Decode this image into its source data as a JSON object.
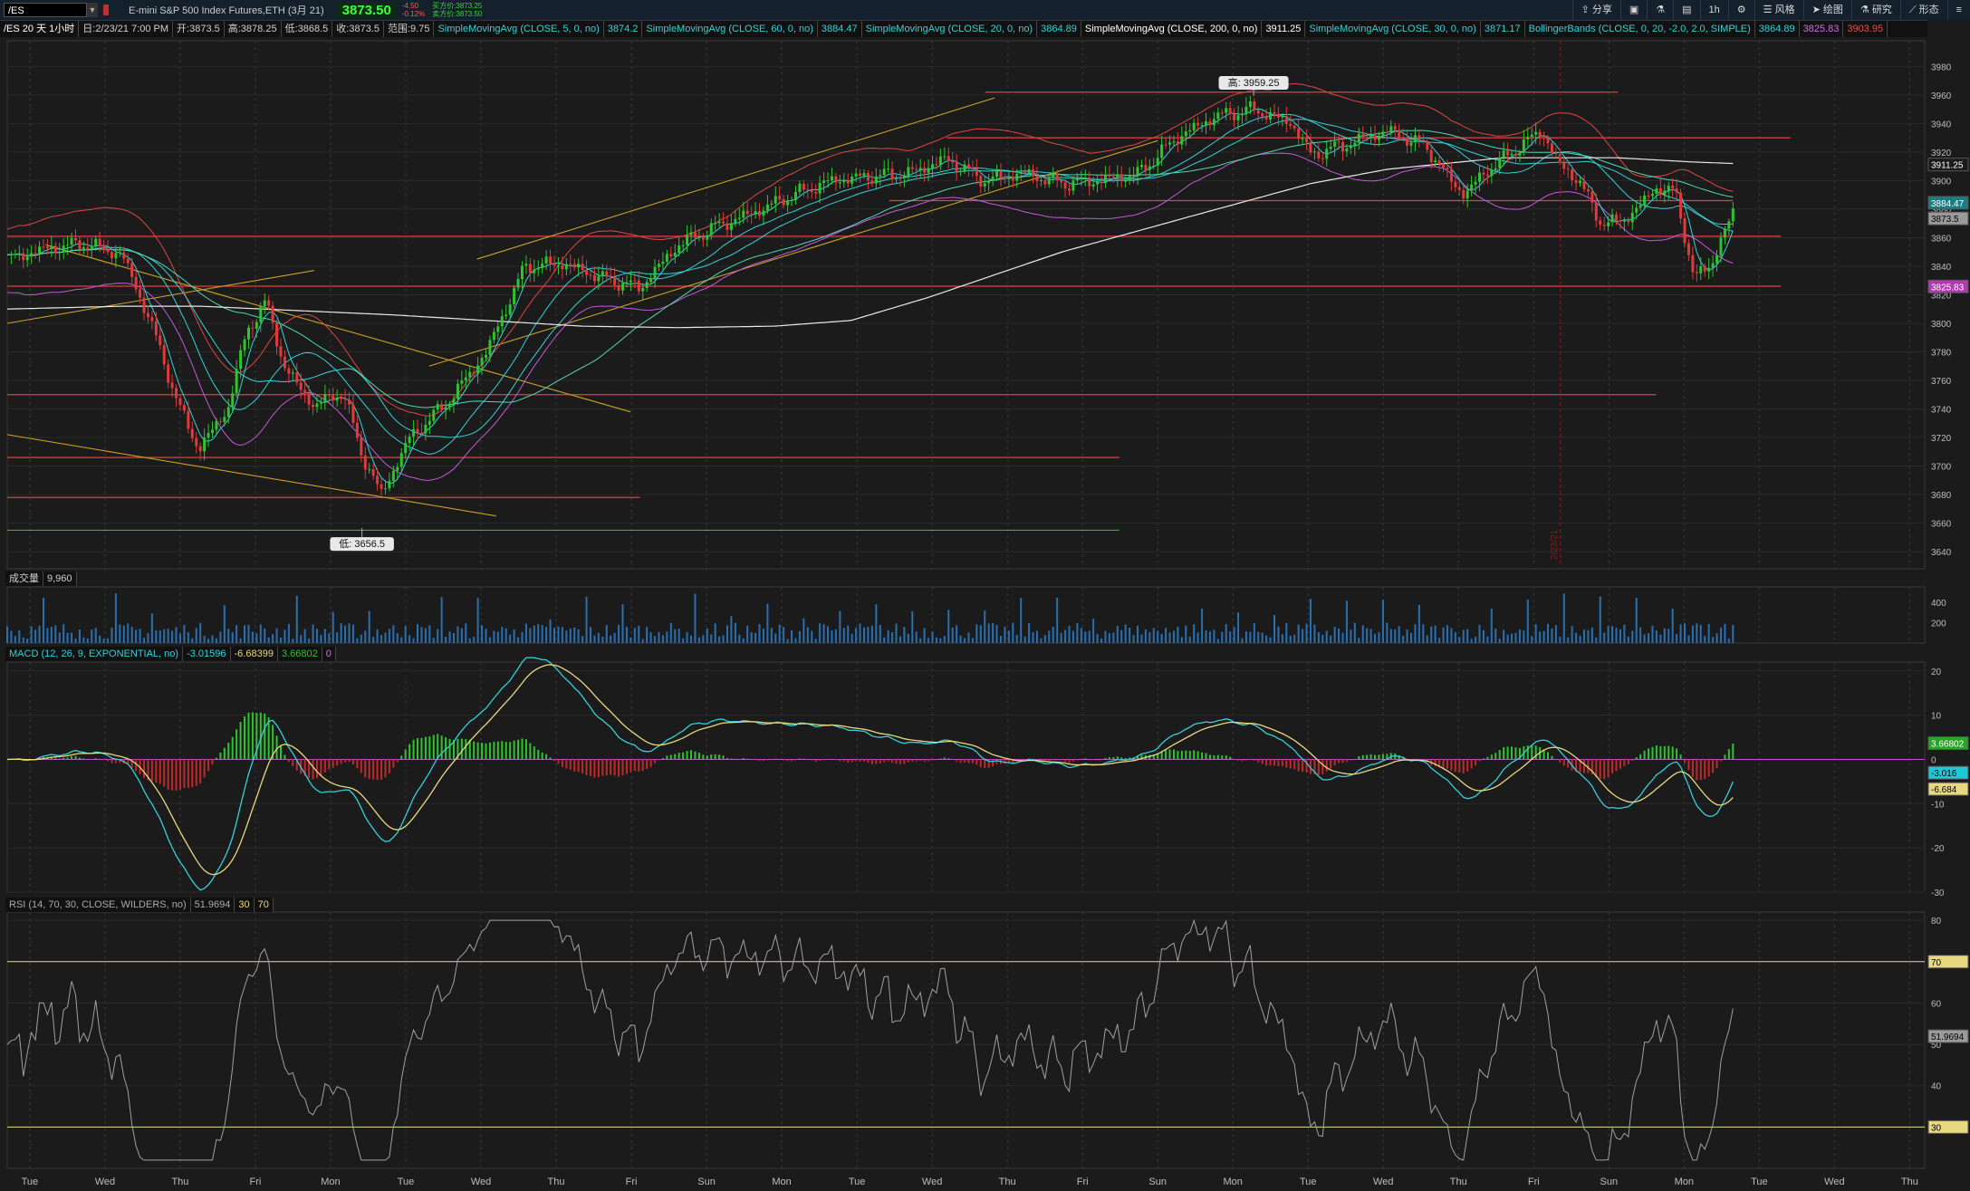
{
  "toolbar": {
    "symbol": "/ES",
    "description": "E-mini S&P 500 Index Futures,ETH (3月 21)",
    "last_price": "3873.50",
    "change": "-4.50",
    "change_pct": "-0.12%",
    "bid": "买方价:3873.25",
    "ask": "卖方价:3873.50",
    "buttons": [
      "分享",
      "",
      "",
      "",
      "1h",
      "",
      "风格",
      "绘图",
      "研究",
      "形态"
    ]
  },
  "info_bar": {
    "timeframe": "/ES 20 天 1小时",
    "date": "日:2/23/21 7:00 PM",
    "open": "开:3873.5",
    "high": "高:3878.25",
    "low": "低:3868.5",
    "close": "收:3873.5",
    "range": "范围:9.75",
    "studies": [
      {
        "label": "SimpleMovingAvg (CLOSE, 5, 0, no)",
        "value": "3874.2",
        "color": "#35d0d8"
      },
      {
        "label": "SimpleMovingAvg (CLOSE, 60, 0, no)",
        "value": "3884.47",
        "color": "#35d0d8"
      },
      {
        "label": "SimpleMovingAvg (CLOSE, 20, 0, no)",
        "value": "3864.89",
        "color": "#35d0d8"
      },
      {
        "label": "SimpleMovingAvg (CLOSE, 200, 0, no)",
        "value": "3911.25",
        "color": "#ffffff"
      },
      {
        "label": "SimpleMovingAvg (CLOSE, 30, 0, no)",
        "value": "3871.17",
        "color": "#35d0d8"
      },
      {
        "label": "BollingerBands (CLOSE, 0, 20, -2.0, 2.0, SIMPLE)",
        "value": "3864.89",
        "value2": "3825.83",
        "value3": "3903.95",
        "color": "#35d0d8"
      }
    ]
  },
  "chart_data": [
    {
      "type": "candlestick",
      "panel": "price",
      "ylim": [
        3628,
        3998
      ],
      "yticks": [
        3640,
        3660,
        3680,
        3700,
        3720,
        3740,
        3760,
        3780,
        3800,
        3820,
        3840,
        3860,
        3880,
        3900,
        3920,
        3940,
        3960,
        3980
      ],
      "x_day_labels": [
        "Tue",
        "Wed",
        "Thu",
        "Fri",
        "Mon",
        "Tue",
        "Wed",
        "Thu",
        "Fri",
        "Sun",
        "Mon",
        "Tue",
        "Wed",
        "Thu",
        "Fri",
        "Sun",
        "Mon",
        "Tue",
        "Wed",
        "Thu",
        "Fri",
        "Sun",
        "Mon",
        "Tue",
        "Wed",
        "Thu"
      ],
      "close_path_points": [
        [
          0,
          3845
        ],
        [
          0.02,
          3852
        ],
        [
          0.04,
          3856
        ],
        [
          0.06,
          3848
        ],
        [
          0.075,
          3800
        ],
        [
          0.09,
          3740
        ],
        [
          0.1,
          3712
        ],
        [
          0.115,
          3740
        ],
        [
          0.125,
          3795
        ],
        [
          0.135,
          3815
        ],
        [
          0.145,
          3768
        ],
        [
          0.16,
          3742
        ],
        [
          0.175,
          3752
        ],
        [
          0.185,
          3708
        ],
        [
          0.195,
          3680
        ],
        [
          0.21,
          3720
        ],
        [
          0.23,
          3745
        ],
        [
          0.25,
          3780
        ],
        [
          0.27,
          3840
        ],
        [
          0.29,
          3842
        ],
        [
          0.31,
          3832
        ],
        [
          0.33,
          3825
        ],
        [
          0.35,
          3855
        ],
        [
          0.37,
          3868
        ],
        [
          0.39,
          3878
        ],
        [
          0.41,
          3890
        ],
        [
          0.43,
          3900
        ],
        [
          0.45,
          3903
        ],
        [
          0.47,
          3905
        ],
        [
          0.49,
          3915
        ],
        [
          0.51,
          3900
        ],
        [
          0.53,
          3905
        ],
        [
          0.55,
          3898
        ],
        [
          0.57,
          3900
        ],
        [
          0.59,
          3905
        ],
        [
          0.61,
          3930
        ],
        [
          0.63,
          3945
        ],
        [
          0.65,
          3950
        ],
        [
          0.67,
          3940
        ],
        [
          0.68,
          3918
        ],
        [
          0.7,
          3926
        ],
        [
          0.72,
          3935
        ],
        [
          0.74,
          3924
        ],
        [
          0.75,
          3905
        ],
        [
          0.76,
          3890
        ],
        [
          0.77,
          3905
        ],
        [
          0.79,
          3925
        ],
        [
          0.8,
          3935
        ],
        [
          0.81,
          3910
        ],
        [
          0.82,
          3900
        ],
        [
          0.83,
          3872
        ],
        [
          0.84,
          3870
        ],
        [
          0.85,
          3880
        ],
        [
          0.86,
          3895
        ],
        [
          0.87,
          3892
        ],
        [
          0.88,
          3830
        ],
        [
          0.89,
          3845
        ],
        [
          0.9,
          3878
        ]
      ],
      "ma200_points": [
        [
          0,
          3810
        ],
        [
          0.06,
          3812
        ],
        [
          0.1,
          3812
        ],
        [
          0.2,
          3806
        ],
        [
          0.3,
          3798
        ],
        [
          0.35,
          3797
        ],
        [
          0.4,
          3798
        ],
        [
          0.44,
          3802
        ],
        [
          0.48,
          3818
        ],
        [
          0.55,
          3850
        ],
        [
          0.62,
          3876
        ],
        [
          0.68,
          3898
        ],
        [
          0.72,
          3908
        ],
        [
          0.78,
          3916
        ],
        [
          0.84,
          3916
        ],
        [
          0.88,
          3913
        ],
        [
          0.9,
          3912
        ]
      ],
      "horizontal_levels": [
        {
          "y": 3962,
          "x0": 0.51,
          "x1": 0.84,
          "color": "#e04040"
        },
        {
          "y": 3930,
          "x0": 0.49,
          "x1": 0.93,
          "color": "#e04040"
        },
        {
          "y": 3886,
          "x0": 0.46,
          "x1": 0.9,
          "color": "#e04040"
        },
        {
          "y": 3861,
          "x0": 0.0,
          "x1": 0.925,
          "color": "#e04040"
        },
        {
          "y": 3826,
          "x0": 0.0,
          "x1": 0.925,
          "color": "#e04040"
        },
        {
          "y": 3750,
          "x0": 0.0,
          "x1": 0.86,
          "color": "#e04040"
        },
        {
          "y": 3706,
          "x0": 0.0,
          "x1": 0.58,
          "color": "#e04040"
        },
        {
          "y": 3678,
          "x0": 0.0,
          "x1": 0.33,
          "color": "#e04040"
        },
        {
          "y": 3655,
          "x0": 0.0,
          "x1": 0.58,
          "color": "#2fb52f"
        }
      ],
      "trend_lines": [
        {
          "x0": 0.0,
          "y0": 3800,
          "x1": 0.16,
          "y1": 3837
        },
        {
          "x0": 0.02,
          "y0": 3855,
          "x1": 0.325,
          "y1": 3738
        },
        {
          "x0": 0.0,
          "y0": 3722,
          "x1": 0.255,
          "y1": 3665
        },
        {
          "x0": 0.245,
          "y0": 3845,
          "x1": 0.515,
          "y1": 3958
        },
        {
          "x0": 0.22,
          "y0": 3770,
          "x1": 0.6,
          "y1": 3928
        }
      ],
      "annotations": [
        {
          "label": "高: 3959.25",
          "x": 0.65,
          "y": 3959.25
        },
        {
          "label": "低: 3656.5",
          "x": 0.185,
          "y": 3656.5
        }
      ],
      "right_labels": [
        {
          "value": "3911.25",
          "y": 3911.25,
          "bg": "#1b1b1b",
          "fg": "#ffffff"
        },
        {
          "value": "3884.47",
          "y": 3884.47,
          "bg": "#1a7f83",
          "fg": "#ffffff"
        },
        {
          "value": "3873.5",
          "y": 3873.5,
          "bg": "#9a9a9a",
          "fg": "#000000"
        },
        {
          "value": "3825.83",
          "y": 3825.83,
          "bg": "#b03ab0",
          "fg": "#ffffff"
        }
      ],
      "vertical_marker": {
        "x": 0.81,
        "label": "2/23/21"
      }
    },
    {
      "type": "bar",
      "panel": "volume",
      "title": "成交量",
      "value": "9,960",
      "yticks": [
        200,
        400
      ],
      "ylim": [
        0,
        550
      ]
    },
    {
      "type": "line",
      "panel": "macd",
      "title": "MACD (12, 26, 9, EXPONENTIAL, no)",
      "values": [
        "-3.01596",
        "-6.68399",
        "3.66802",
        "0"
      ],
      "ylim": [
        -30,
        22
      ],
      "yticks": [
        -30,
        -20,
        -10,
        0,
        10,
        20
      ],
      "right_labels": [
        {
          "value": "3.66802",
          "y": 3.66802,
          "bg": "#2aa52a",
          "fg": "#ffffff"
        },
        {
          "value": "-3.016",
          "y": -3.016,
          "bg": "#1ec8d8",
          "fg": "#000000"
        },
        {
          "value": "-6.684",
          "y": -6.684,
          "bg": "#e8d880",
          "fg": "#000000"
        }
      ]
    },
    {
      "type": "line",
      "panel": "rsi",
      "title": "RSI (14, 70, 30, CLOSE, WILDERS, no)",
      "values": [
        "51.9694",
        "30",
        "70"
      ],
      "ylim": [
        20,
        82
      ],
      "yticks": [
        30,
        40,
        50,
        60,
        70,
        80
      ],
      "overbought": 70,
      "oversold": 30,
      "right_labels": [
        {
          "value": "70",
          "y": 70,
          "bg": "#e8d880",
          "fg": "#000000"
        },
        {
          "value": "51.9694",
          "y": 51.9694,
          "bg": "#9a9a9a",
          "fg": "#000000"
        },
        {
          "value": "30",
          "y": 30,
          "bg": "#e8d880",
          "fg": "#000000"
        }
      ]
    }
  ],
  "colors": {
    "background": "#1b1b1b",
    "up_candle": "#2fc42f",
    "down_candle": "#e03a3a",
    "ma_cyan": "#35d0d8",
    "ma_white": "#e8e8e8",
    "bollinger": "#e04444",
    "ma_magenta": "#c45ad8",
    "macd_line": "#35d0d8",
    "signal_line": "#e8d880",
    "rsi_line": "#a0a0a0"
  }
}
